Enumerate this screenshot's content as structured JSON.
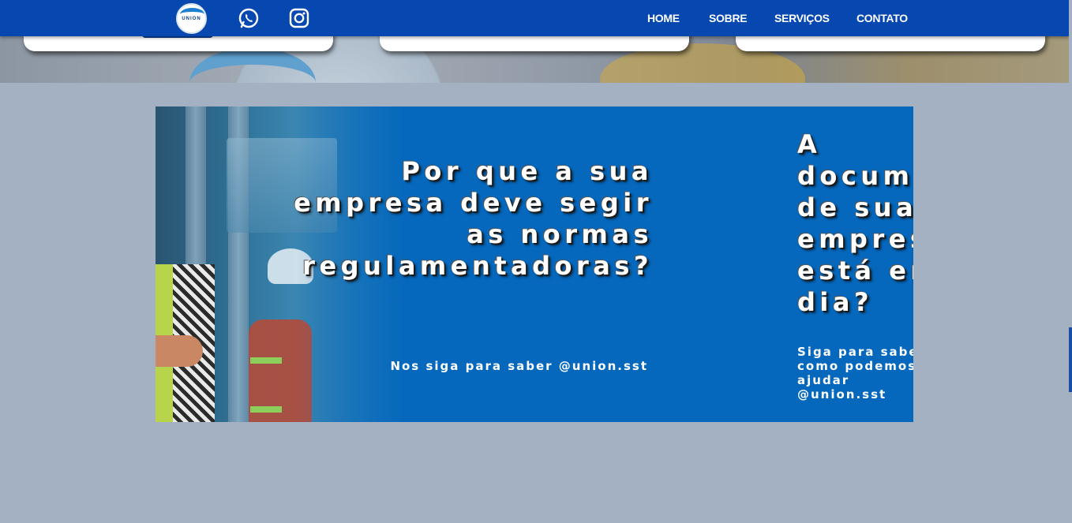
{
  "brand": {
    "logo_text": "UNION"
  },
  "colors": {
    "navbar": "#0748b0",
    "banner": "#0568bd",
    "page_bg": "#a3b1c2"
  },
  "nav": {
    "social": [
      {
        "icon": "whatsapp-icon"
      },
      {
        "icon": "instagram-icon"
      }
    ],
    "links": [
      "HOME",
      "SOBRE",
      "SERVIÇOS",
      "CONTATO"
    ]
  },
  "banner": {
    "slides": [
      {
        "headline": "Por que a sua\nempresa deve segir\nas normas\nregulamentadoras?",
        "cta": "Nos siga para saber @union.sst"
      },
      {
        "headline": "A documentação\nde sua empresa\nestá em\ndia?",
        "cta": "Siga para saber\ncomo podemos\najudar\n@union.sst"
      }
    ]
  }
}
